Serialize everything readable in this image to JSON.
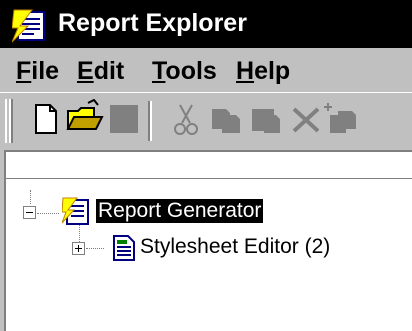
{
  "window": {
    "title": "Report Explorer",
    "app_icon": "report-explorer-icon"
  },
  "menu": {
    "items": [
      {
        "label": "File",
        "access_key": "F"
      },
      {
        "label": "Edit",
        "access_key": "E"
      },
      {
        "label": "Tools",
        "access_key": "T"
      },
      {
        "label": "Help",
        "access_key": "H"
      }
    ]
  },
  "toolbar": {
    "buttons": [
      {
        "icon": "new-icon",
        "enabled": true
      },
      {
        "icon": "open-folder-icon",
        "enabled": true
      },
      {
        "icon": "save-icon",
        "enabled": false
      },
      {
        "icon": "cut-icon",
        "enabled": false
      },
      {
        "icon": "copy-icon",
        "enabled": false
      },
      {
        "icon": "paste-icon",
        "enabled": false
      },
      {
        "icon": "delete-icon",
        "enabled": false
      },
      {
        "icon": "properties-icon",
        "enabled": false
      }
    ]
  },
  "tree": {
    "nodes": [
      {
        "label": "Report Generator",
        "expanded": true,
        "selected": true,
        "icon": "report-generator-icon"
      },
      {
        "label": "Stylesheet Editor (2)",
        "expanded": false,
        "selected": false,
        "icon": "stylesheet-icon"
      }
    ]
  },
  "colors": {
    "titlebar": "#000000",
    "face": "#c0c0c0",
    "selection": "#000000",
    "disabled_icon": "#808080"
  }
}
